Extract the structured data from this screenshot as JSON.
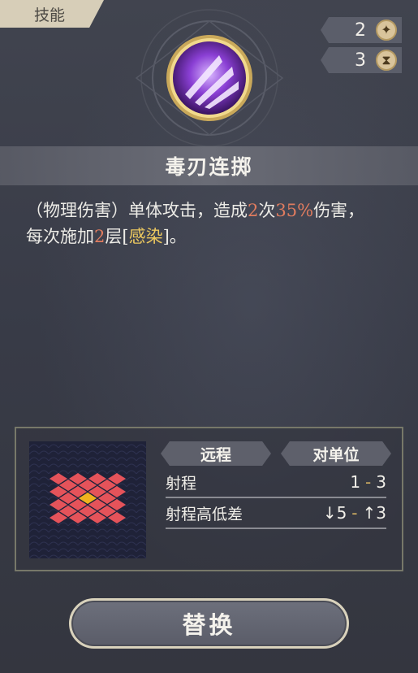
{
  "tab": {
    "label": "技能"
  },
  "stats": [
    {
      "value": "2",
      "icon": "sparkle-icon"
    },
    {
      "value": "3",
      "icon": "hourglass-icon"
    }
  ],
  "skill": {
    "name": "毒刃连掷",
    "desc": {
      "l1_a": "（物理伤害）单体攻击，造成",
      "l1_n1": "2",
      "l1_b": "次",
      "l1_n2": "35%",
      "l1_c": "伤害，",
      "l2_a": "每次施加",
      "l2_n": "2",
      "l2_b": "层[",
      "l2_kw": "感染",
      "l2_c": "]。"
    }
  },
  "info": {
    "tag_type": "远程",
    "tag_target": "对单位",
    "range_label": "射程",
    "range_min": "1",
    "range_max": "3",
    "height_label": "射程高低差",
    "height_down": "↓5",
    "height_up": "↑3"
  },
  "button": {
    "label": "替换"
  },
  "colors": {
    "highlight_number": "#e07c5f",
    "highlight_keyword": "#ecc85f",
    "range_cell": "#e5535a",
    "center_cell": "#f0b21e",
    "grid_bg": "#1f2238"
  }
}
